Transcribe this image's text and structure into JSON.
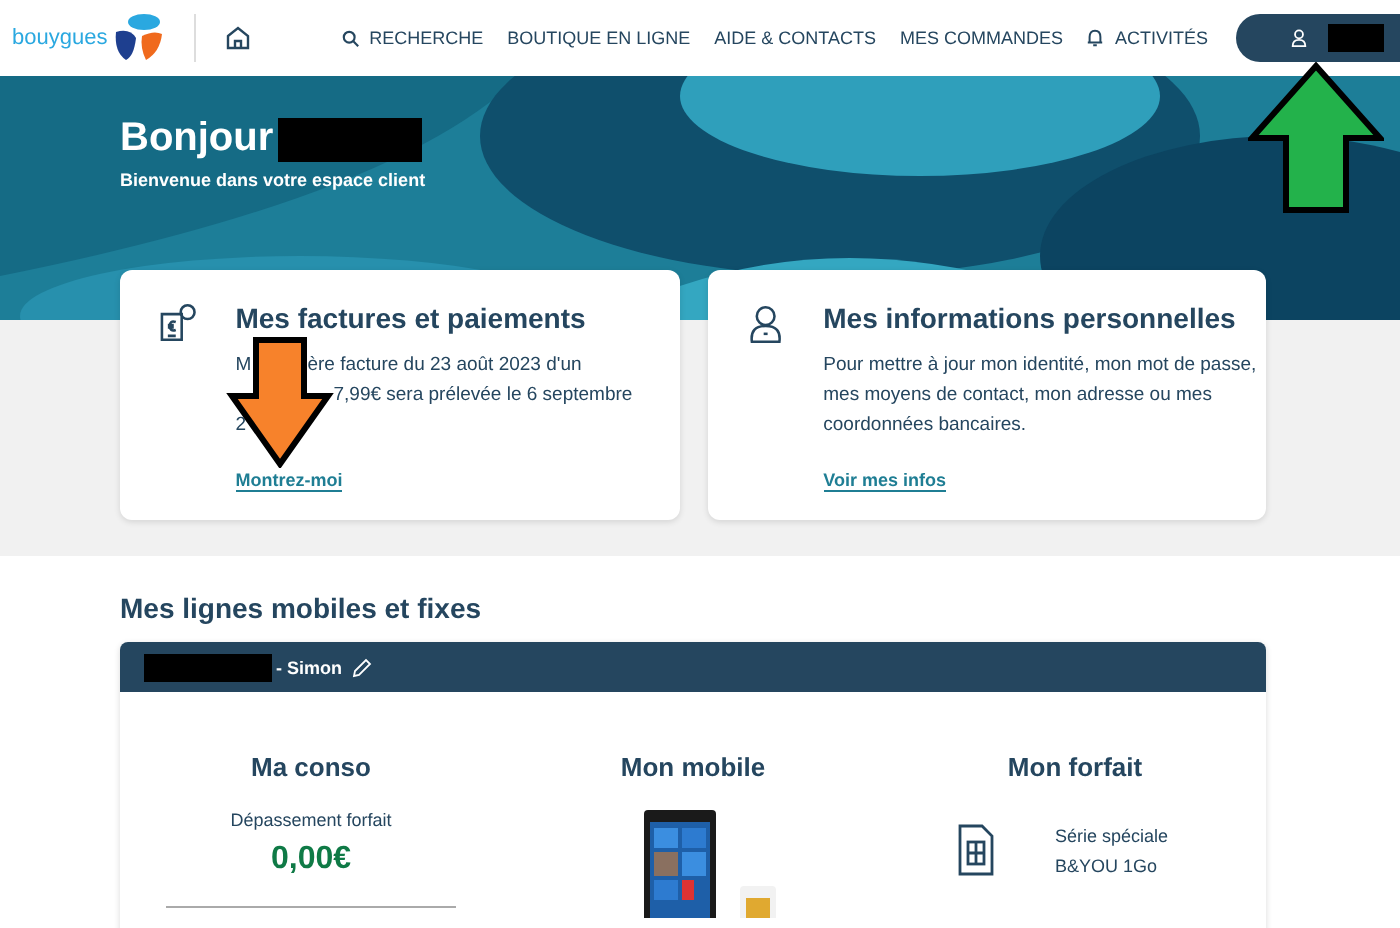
{
  "header": {
    "logo": "bouygues",
    "nav": [
      {
        "label": "RECHERCHE"
      },
      {
        "label": "BOUTIQUE EN LIGNE"
      },
      {
        "label": "AIDE & CONTACTS"
      },
      {
        "label": "MES COMMANDES"
      },
      {
        "label": "ACTIVITÉS"
      }
    ]
  },
  "hero": {
    "greeting": "Bonjour",
    "subtitle": "Bienvenue dans votre espace client"
  },
  "cards": [
    {
      "title": "Mes factures et paiements",
      "lines": [
        {
          "before": "M",
          "after": "ère facture du 23 août 2023 d'un"
        },
        {
          "after": "7,99€ sera prélevée le 6 septembre"
        },
        {
          "before": "2"
        }
      ],
      "link": "Montrez-moi"
    },
    {
      "title": "Mes informations personnelles",
      "text": "Pour mettre à jour mon identité, mon mot de passe, mes moyens de contact, mon adresse ou mes coordonnées bancaires.",
      "link": "Voir mes infos"
    }
  ],
  "lines_section": {
    "title": "Mes lignes mobiles et fixes",
    "line_name": "- Simon",
    "columns": [
      {
        "kind": "conso",
        "title": "Ma conso",
        "label": "Dépassement forfait",
        "amount": "0,00€"
      },
      {
        "kind": "mobile",
        "title": "Mon mobile"
      },
      {
        "kind": "forfait",
        "title": "Mon forfait",
        "plan": "Série spéciale B&YOU 1Go"
      }
    ]
  }
}
